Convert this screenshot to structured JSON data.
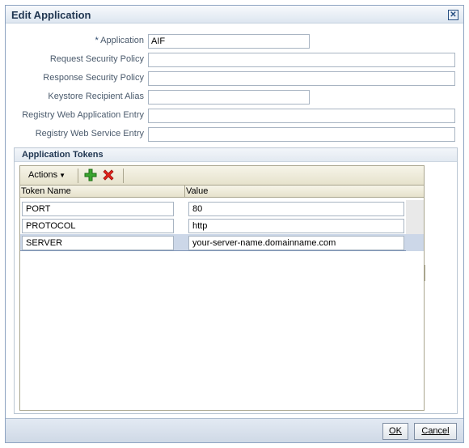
{
  "dialog": {
    "title": "Edit  Application",
    "close_symbol": "✕"
  },
  "form": {
    "application": {
      "label_required_mark": "*",
      "label": "Application",
      "value": "AIF"
    },
    "request_security_policy": {
      "label": "Request Security Policy",
      "value": ""
    },
    "response_security_policy": {
      "label": "Response Security Policy",
      "value": ""
    },
    "keystore_recipient_alias": {
      "label": "Keystore Recipient Alias",
      "value": ""
    },
    "registry_web_application_entry": {
      "label": "Registry Web Application Entry",
      "value": ""
    },
    "registry_web_service_entry": {
      "label": "Registry Web Service Entry",
      "value": ""
    }
  },
  "tokens": {
    "section_title": "Application Tokens",
    "actions_label": "Actions",
    "add_icon": "plus-icon",
    "delete_icon": "red-x-icon",
    "columns": {
      "name": "Token Name",
      "value": "Value"
    },
    "rows": [
      {
        "name": "PORT",
        "value": "80"
      },
      {
        "name": "PROTOCOL",
        "value": "http"
      },
      {
        "name": "SERVER",
        "value": "your-server-name.domainname.com"
      }
    ],
    "selected_row": "SERVER"
  },
  "buttons": {
    "ok": "OK",
    "cancel": "Cancel"
  },
  "colors": {
    "title_text": "#1f3550",
    "label_text": "#4a5a6c",
    "selected_row": "#ccd7e8",
    "toolbar": "#e6e2cc"
  }
}
